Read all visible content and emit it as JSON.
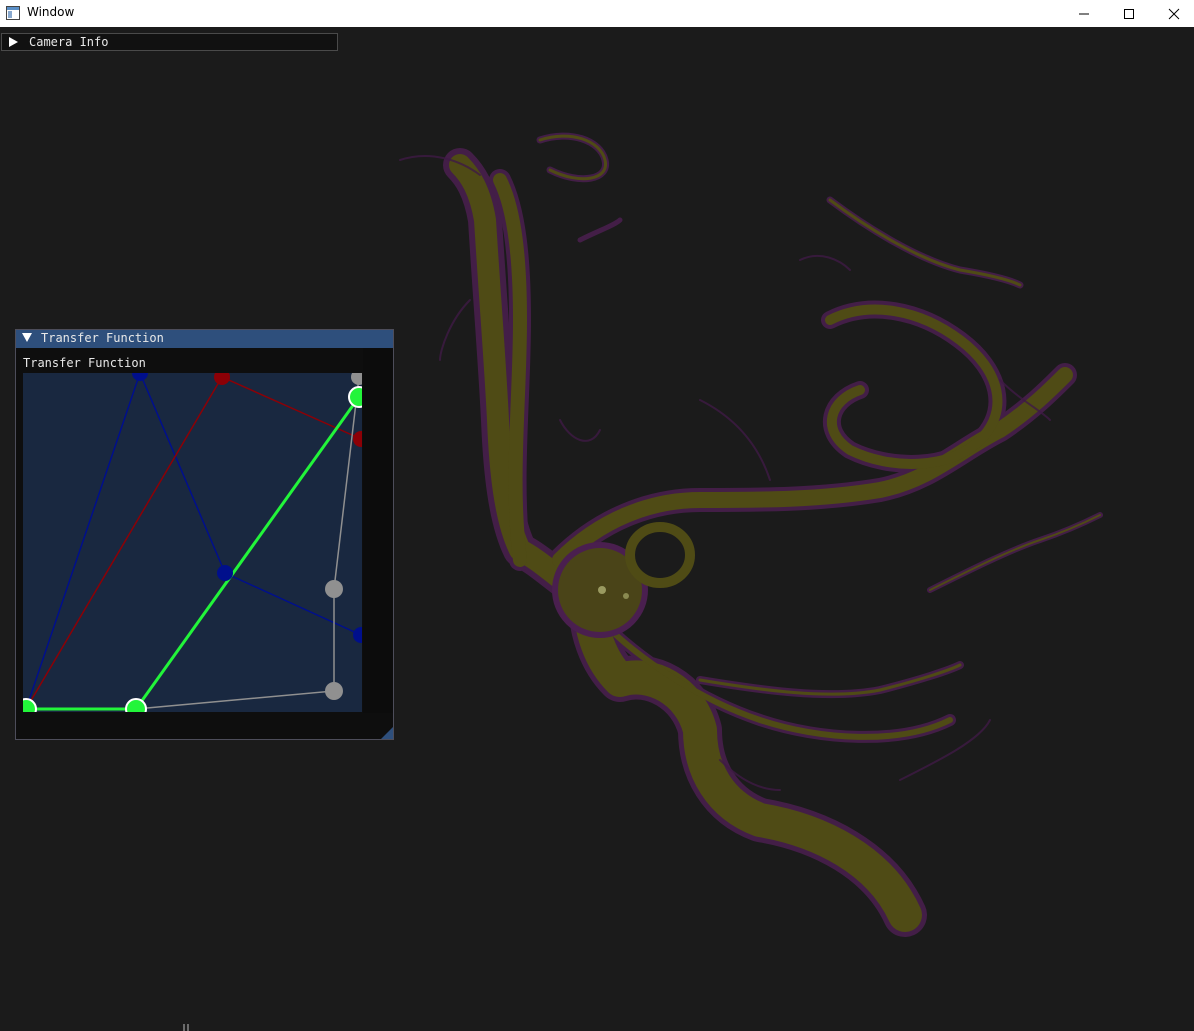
{
  "window": {
    "title": "Window",
    "icons": {
      "app": "app-window-icon",
      "minimize": "minimize-icon",
      "maximize": "maximize-icon",
      "close": "close-icon"
    }
  },
  "camera_info": {
    "label": "Camera Info",
    "collapsed": true,
    "icon": "triangle-right-icon"
  },
  "transfer_function": {
    "window_title": "Transfer Function",
    "canvas_label": "Transfer Function",
    "collapsed": false,
    "icon": "triangle-down-icon",
    "colors": {
      "background": "#192840",
      "blue": "#000f8c",
      "red": "#8c0006",
      "green": "#22f53a",
      "gray": "#909090"
    }
  },
  "colors": {
    "viewport_bg": "#1b1b1b",
    "header_active": "#2e4f7c",
    "vessel_olive": "#4f4b15",
    "vessel_purple": "#4a1f4f"
  }
}
